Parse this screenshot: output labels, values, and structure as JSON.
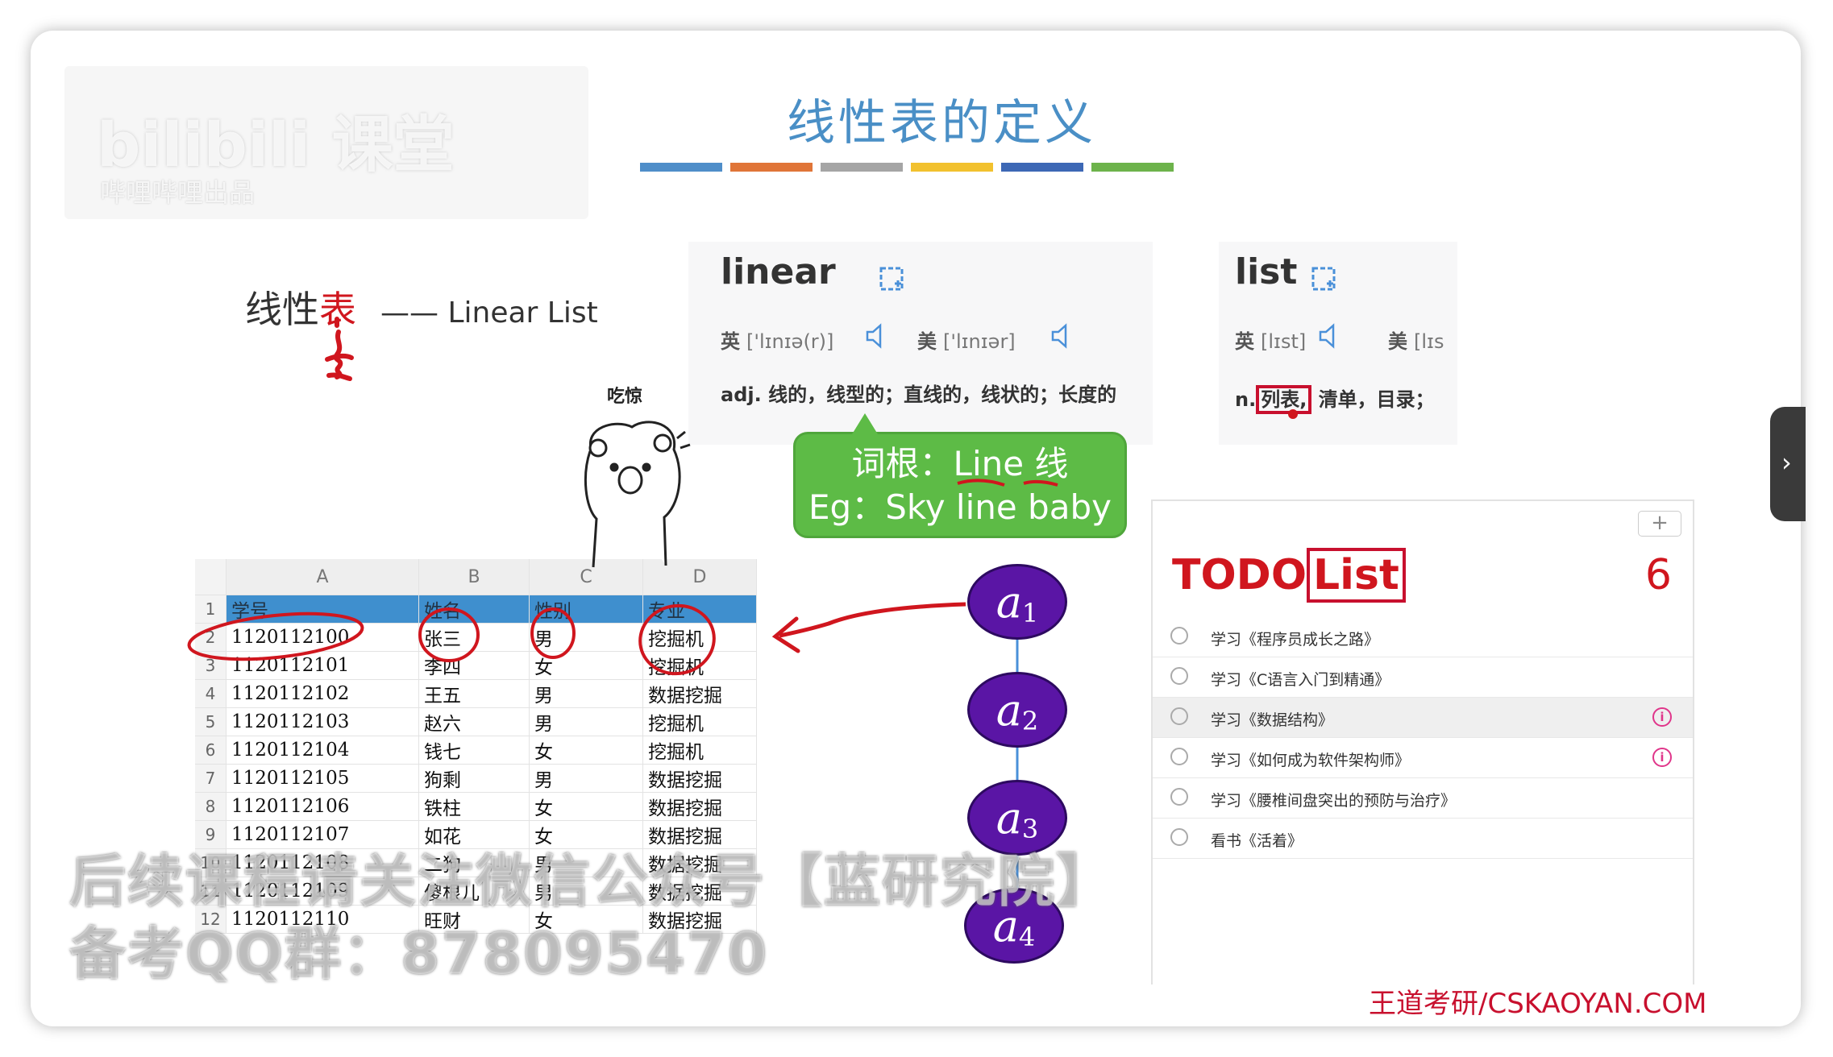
{
  "watermark_logo": {
    "line1": "bilibili 课堂",
    "line2": "哔哩哔哩出品"
  },
  "title": "线性表的定义",
  "title_bar_colors": [
    "#4f8ec9",
    "#e07538",
    "#a5a5a5",
    "#f2c12e",
    "#3d68b5",
    "#6db34b"
  ],
  "term": {
    "cn_black": "线性",
    "cn_red": "表",
    "en": "—— Linear List"
  },
  "sticker_label": "吃惊",
  "dict_linear": {
    "word": "linear",
    "uk_label": "英",
    "uk_phonetic": "['lɪnɪə(r)]",
    "us_label": "美",
    "us_phonetic": "['lɪnɪər]",
    "definition": "adj. 线的，线型的；直线的，线状的；长度的"
  },
  "dict_list": {
    "word": "list",
    "uk_label": "英",
    "uk_phonetic": "[lɪst]",
    "us_label": "美",
    "us_phonetic": "[lɪs",
    "def_prefix": "n.",
    "def_highlight": "列表,",
    "def_rest": "清单，目录；"
  },
  "callout": {
    "line1": "词根：Line 线",
    "line2": "Eg：Sky line baby"
  },
  "spreadsheet": {
    "columns": [
      "A",
      "B",
      "C",
      "D"
    ],
    "header_row": {
      "num": "1",
      "a": "学号",
      "b": "姓名",
      "c": "性别",
      "d": "专业"
    },
    "rows": [
      {
        "num": "2",
        "a": "1120112100",
        "b": "张三",
        "c": "男",
        "d": "挖掘机"
      },
      {
        "num": "3",
        "a": "1120112101",
        "b": "李四",
        "c": "女",
        "d": "挖掘机"
      },
      {
        "num": "4",
        "a": "1120112102",
        "b": "王五",
        "c": "男",
        "d": "数据挖掘"
      },
      {
        "num": "5",
        "a": "1120112103",
        "b": "赵六",
        "c": "男",
        "d": "挖掘机"
      },
      {
        "num": "6",
        "a": "1120112104",
        "b": "钱七",
        "c": "女",
        "d": "挖掘机"
      },
      {
        "num": "7",
        "a": "1120112105",
        "b": "狗剩",
        "c": "男",
        "d": "数据挖掘"
      },
      {
        "num": "8",
        "a": "1120112106",
        "b": "铁柱",
        "c": "女",
        "d": "数据挖掘"
      },
      {
        "num": "9",
        "a": "1120112107",
        "b": "如花",
        "c": "女",
        "d": "数据挖掘"
      },
      {
        "num": "10",
        "a": "1120112108",
        "b": "二狗",
        "c": "男",
        "d": "数据挖掘"
      },
      {
        "num": "11",
        "a": "1120112109",
        "b": "傻根儿",
        "c": "男",
        "d": "数据挖掘"
      },
      {
        "num": "12",
        "a": "1120112110",
        "b": "旺财",
        "c": "女",
        "d": "数据挖掘"
      }
    ]
  },
  "nodes": [
    {
      "letter": "a",
      "sub": "1"
    },
    {
      "letter": "a",
      "sub": "2"
    },
    {
      "letter": "a",
      "sub": "3"
    },
    {
      "letter": "a",
      "sub": "4"
    }
  ],
  "todo": {
    "add_label": "+",
    "title_a": "TODO",
    "title_b": "List",
    "count": "6",
    "items": [
      {
        "text": "学习《程序员成长之路》"
      },
      {
        "text": "学习《C语言入门到精通》"
      },
      {
        "text": "学习《数据结构》",
        "info": "i"
      },
      {
        "text": "学习《如何成为软件架构师》",
        "info": "i"
      },
      {
        "text": "学习《腰椎间盘突出的预防与治疗》"
      },
      {
        "text": "看书《活着》"
      }
    ]
  },
  "watermark_text": {
    "line1": "后续课程请关注微信公众号【蓝研究院】",
    "line2": "备考QQ群：878095470"
  },
  "footer": "王道考研/CSKAOYAN.COM",
  "side_tab_icon": "›"
}
